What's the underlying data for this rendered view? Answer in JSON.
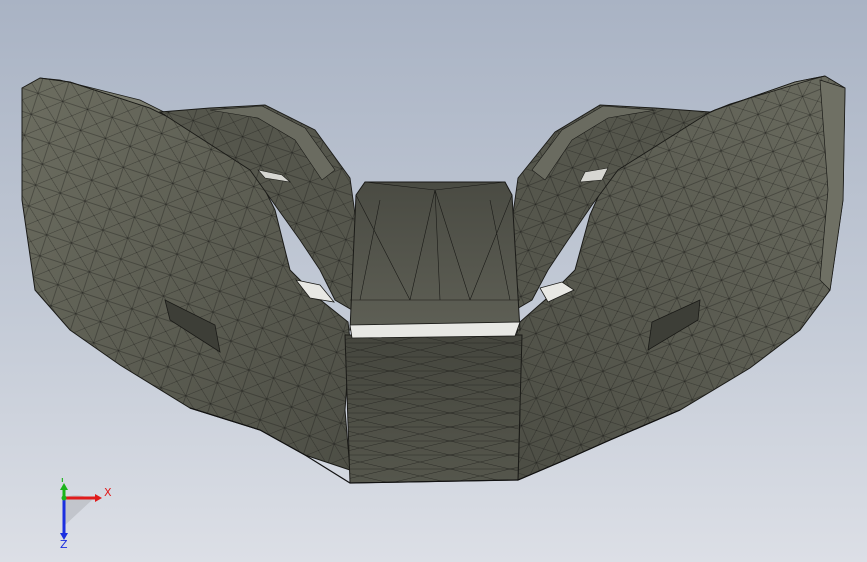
{
  "viewport": {
    "background_top": "#a9b3c4",
    "background_bottom": "#dcdfe6"
  },
  "model": {
    "shading": "shaded-with-edges",
    "face_color": "#5f6054",
    "edge_color": "#1a1a17",
    "highlight_color": "#e8e8e4"
  },
  "triad": {
    "x_label": "X",
    "y_label": "Y",
    "z_label": "Z",
    "x_color": "#e01b1b",
    "y_color": "#1bb31b",
    "z_color": "#1b2fe0"
  }
}
